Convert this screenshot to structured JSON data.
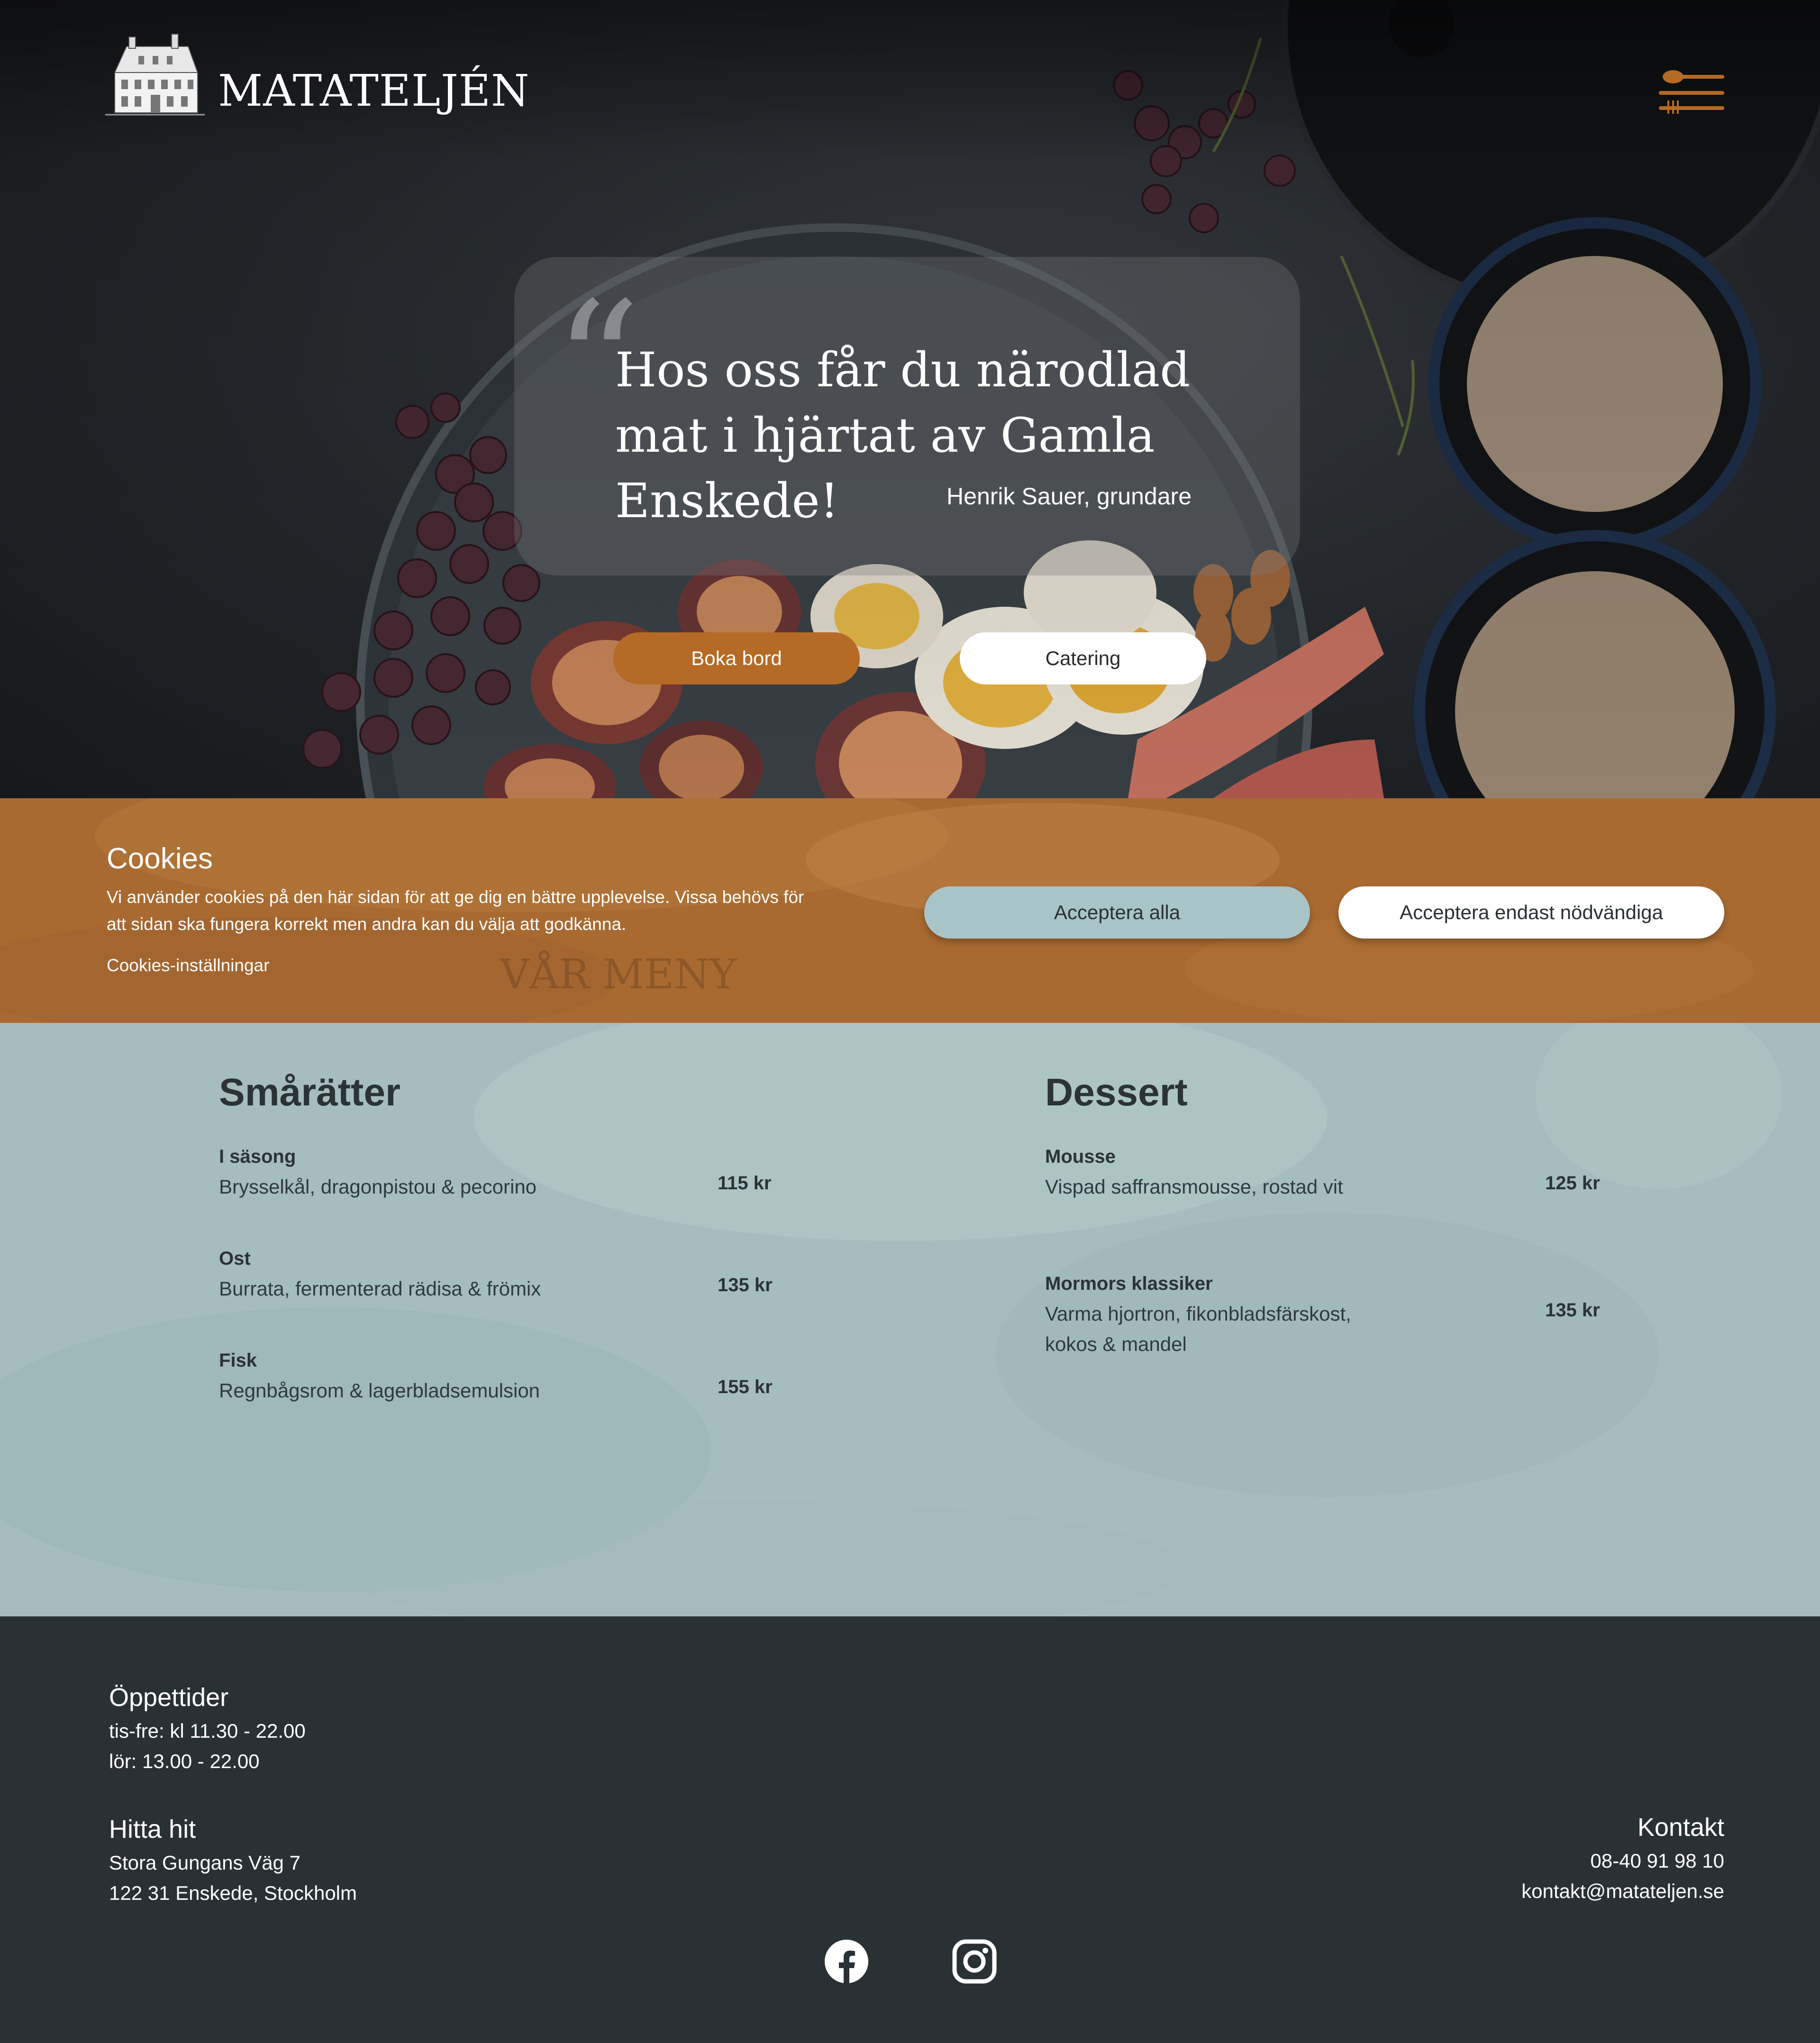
{
  "brand": {
    "name": "MATATELJÉN"
  },
  "hero": {
    "quote": "Hos oss får du närodlad mat i hjärtat av Gamla Enskede!",
    "author": "Henrik Sauer, grundare",
    "buttons": {
      "book": "Boka bord",
      "catering": "Catering"
    }
  },
  "cookies": {
    "title": "Cookies",
    "text": "Vi använder cookies på den här sidan för att ge dig en bättre upplevelse. Vissa behövs för att sidan ska fungera korrekt men andra kan du välja att godkänna.",
    "settings_link": "Cookies-inställningar",
    "accept_all": "Acceptera alla",
    "accept_necessary": "Acceptera endast nödvändiga",
    "behind_text": "VÅR MENY"
  },
  "menu": {
    "small_dishes": {
      "title": "Smårätter",
      "items": [
        {
          "name": "I säsong",
          "desc": "Brysselkål, dragonpistou & pecorino",
          "price": "115 kr"
        },
        {
          "name": "Ost",
          "desc": "Burrata, fermenterad rädisa & frömix",
          "price": "135 kr"
        },
        {
          "name": "Fisk",
          "desc": "Regnbågsrom & lagerbladsemulsion",
          "price": "155 kr"
        }
      ]
    },
    "dessert": {
      "title": "Dessert",
      "items": [
        {
          "name": "Mousse",
          "desc": "Vispad saffransmousse, rostad vit",
          "price": "125 kr"
        },
        {
          "name": "Mormors klassiker",
          "desc": "Varma hjortron, fikonbladsfärskost, kokos & mandel",
          "price": "135 kr"
        }
      ]
    }
  },
  "footer": {
    "hours": {
      "title": "Öppettider",
      "line1": "tis-fre: kl 11.30 - 22.00",
      "line2": "lör: 13.00 - 22.00"
    },
    "directions": {
      "title": "Hitta hit",
      "line1": "Stora Gungans Väg 7",
      "line2": "122 31 Enskede, Stockholm"
    },
    "contact": {
      "title": "Kontakt",
      "phone": "08-40 91 98 10",
      "email": "kontakt@matateljen.se"
    },
    "social": {
      "facebook_icon": "facebook-icon",
      "instagram_icon": "instagram-icon"
    }
  },
  "colors": {
    "accent": "#b56a25",
    "cookie_bg": "#a86a31",
    "menu_bg": "#a5bdbf",
    "footer_bg": "#2a3135",
    "button_teal": "#a9c4c6"
  }
}
